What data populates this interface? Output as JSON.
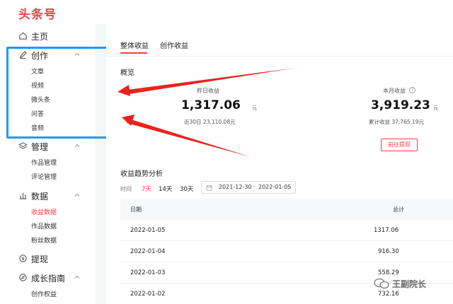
{
  "header": {
    "logo": "头条号"
  },
  "sidebar": {
    "groups": [
      {
        "label": "主页"
      },
      {
        "label": "创作",
        "items": [
          "文章",
          "视频",
          "微头条",
          "问答",
          "音频"
        ]
      },
      {
        "label": "管理",
        "items": [
          "作品管理",
          "评论管理"
        ]
      },
      {
        "label": "数据",
        "items": [
          "收益数据",
          "作品数据",
          "粉丝数据"
        ]
      },
      {
        "label": "提现"
      },
      {
        "label": "成长指南",
        "items": [
          "创作权益"
        ]
      }
    ],
    "active_item": "收益数据"
  },
  "tabs": [
    {
      "label": "整体收益",
      "active": true
    },
    {
      "label": "创作收益",
      "active": false
    }
  ],
  "overview": {
    "title": "概览",
    "yesterday": {
      "label": "昨日收益",
      "value": "1,317.06",
      "unit": "元",
      "sub": "近30日 23,110.08元"
    },
    "month": {
      "label": "本月收益",
      "value": "3,919.23",
      "unit": "元",
      "sub": "累计收益 37,765.19元"
    },
    "withdraw_button": "前往提现"
  },
  "trend": {
    "title": "收益趋势分析",
    "filter_label": "时间",
    "options": [
      {
        "label": "7天",
        "active": true
      },
      {
        "label": "14天",
        "active": false
      },
      {
        "label": "30天",
        "active": false
      }
    ],
    "date_start": "2021-12-30",
    "date_sep": "~",
    "date_end": "2022-01-05"
  },
  "table": {
    "columns": [
      "日期",
      "总计"
    ],
    "rows": [
      [
        "2022-01-05",
        "1317.06"
      ],
      [
        "2022-01-04",
        "916.30"
      ],
      [
        "2022-01-03",
        "558.29"
      ],
      [
        "2022-01-02",
        "732.16"
      ]
    ]
  },
  "watermark": {
    "text": "王副院长"
  },
  "colors": {
    "brand": "#f04142",
    "highlight": "#1a9bf0"
  }
}
